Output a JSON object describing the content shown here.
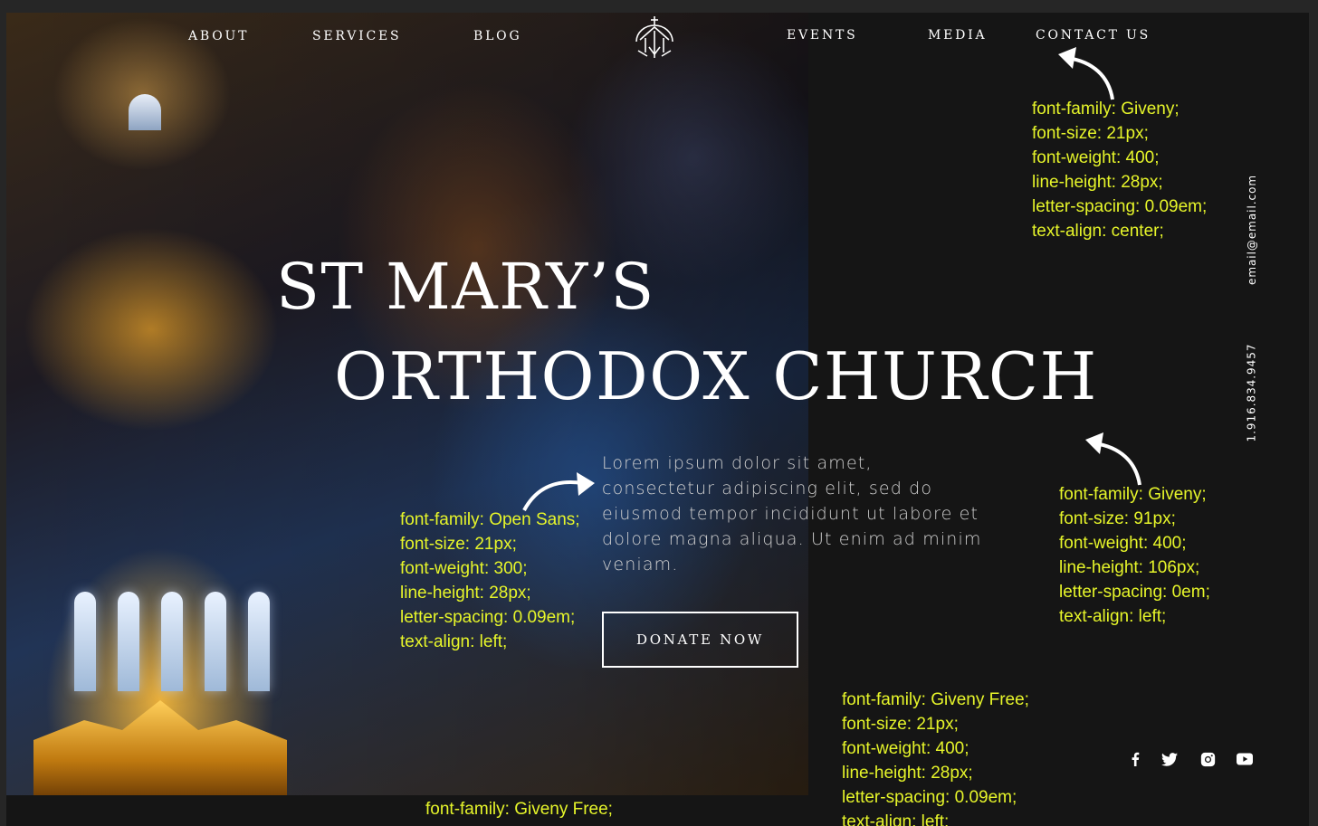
{
  "nav": {
    "left": [
      "ABOUT",
      "SERVICES",
      "BLOG"
    ],
    "right": [
      "EVENTS",
      "MEDIA",
      "CONTACT US"
    ]
  },
  "hero": {
    "title_line1": "ST MARY’S",
    "title_line2": "ORTHODOX CHURCH",
    "body": "Lorem ipsum dolor sit amet, consectetur adipiscing elit, sed do eiusmod tempor incididunt ut labore et dolore magna aliqua. Ut enim ad minim veniam.",
    "cta": "DONATE NOW"
  },
  "contact": {
    "email": "email@email.com",
    "phone": "1.916.834.9457"
  },
  "social_icons": [
    "facebook-icon",
    "twitter-icon",
    "instagram-icon",
    "youtube-icon"
  ],
  "annotations": {
    "nav_spec": [
      "font-family: Giveny;",
      "font-size: 21px;",
      "font-weight: 400;",
      "line-height: 28px;",
      "letter-spacing: 0.09em;",
      "text-align: center;"
    ],
    "title_spec": [
      "font-family: Giveny;",
      "font-size: 91px;",
      "font-weight: 400;",
      "line-height: 106px;",
      "letter-spacing: 0em;",
      "text-align: left;"
    ],
    "body_spec": [
      "font-family: Open Sans;",
      "font-size: 21px;",
      "font-weight: 300;",
      "line-height: 28px;",
      "letter-spacing: 0.09em;",
      "text-align: left;"
    ],
    "button_spec": [
      "font-family: Giveny Free;",
      "font-size: 21px;",
      "font-weight: 400;",
      "line-height: 28px;",
      "letter-spacing: 0.09em;",
      "text-align: left;"
    ],
    "bottom_spec": "font-family: Giveny Free;"
  },
  "colors": {
    "annotation": "#e6f52a",
    "background": "#151515",
    "text": "#ffffff"
  }
}
